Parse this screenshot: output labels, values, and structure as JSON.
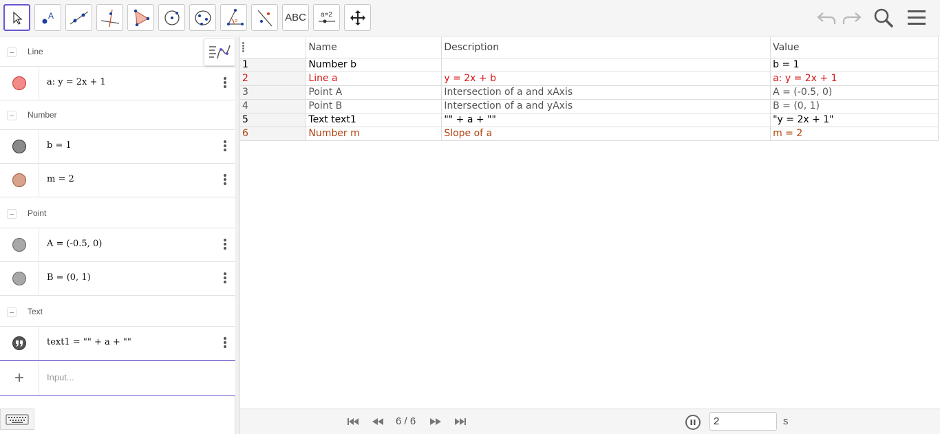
{
  "toolbar": {
    "tools": [
      {
        "name": "move",
        "icon": "arrow-cursor-icon"
      },
      {
        "name": "point",
        "icon": "point-icon"
      },
      {
        "name": "line",
        "icon": "line-icon"
      },
      {
        "name": "perpendicular",
        "icon": "perpendicular-line-icon"
      },
      {
        "name": "polygon",
        "icon": "polygon-icon"
      },
      {
        "name": "circle",
        "icon": "circle-center-icon"
      },
      {
        "name": "ellipse",
        "icon": "ellipse-icon"
      },
      {
        "name": "angle",
        "icon": "angle-icon"
      },
      {
        "name": "reflect",
        "icon": "reflect-icon"
      },
      {
        "name": "text",
        "label": "ABC"
      },
      {
        "name": "slider",
        "label": "a=2"
      },
      {
        "name": "move-graphics",
        "icon": "move-arrows-icon"
      }
    ],
    "active_tool": "move"
  },
  "algebra": {
    "groups": [
      {
        "label": "Line",
        "items": [
          {
            "text": "a: y = 2x + 1",
            "color": "#f08080"
          }
        ]
      },
      {
        "label": "Number",
        "items": [
          {
            "text": "b = 1",
            "color": "#8a8a8a"
          },
          {
            "text": "m = 2",
            "color": "#d4a088"
          }
        ]
      },
      {
        "label": "Point",
        "items": [
          {
            "text": "A = (-0.5, 0)",
            "color": "#a8a8a8"
          },
          {
            "text": "B = (0, 1)",
            "color": "#a8a8a8"
          }
        ]
      },
      {
        "label": "Text",
        "items": [
          {
            "text": "text1 = \"\" + a + \"\"",
            "color": "#555555"
          }
        ]
      }
    ],
    "input_placeholder": "Input..."
  },
  "protocol": {
    "headers": {
      "no": "",
      "name": "Name",
      "description": "Description",
      "value": "Value"
    },
    "rows": [
      {
        "no": "1",
        "name": "Number b",
        "description": "",
        "value": "b = 1",
        "color": "#000000",
        "bg": "#ffffff"
      },
      {
        "no": "2",
        "name": "Line a",
        "description": "y = 2x + b",
        "value": "a: y = 2x + 1",
        "color": "#d61818",
        "bg": "#ffffff"
      },
      {
        "no": "3",
        "name": "Point A",
        "description": "Intersection of a and xAxis",
        "value": "A = (-0.5, 0)",
        "color": "#555555",
        "bg": "#ffffff"
      },
      {
        "no": "4",
        "name": "Point B",
        "description": "Intersection of a and yAxis",
        "value": "B = (0, 1)",
        "color": "#555555",
        "bg": "#ffffff"
      },
      {
        "no": "5",
        "name": "Text text1",
        "description": "\"\" + a + \"\"",
        "value": "\"y = 2x + 1\"",
        "color": "#000000",
        "bg": "#ffffff"
      },
      {
        "no": "6",
        "name": "Number m",
        "description": "Slope of a",
        "value": "m = 2",
        "color": "#b0420e",
        "bg": "#ffffff"
      }
    ]
  },
  "playbar": {
    "step": "6 / 6",
    "delay": "2",
    "unit": "s"
  }
}
